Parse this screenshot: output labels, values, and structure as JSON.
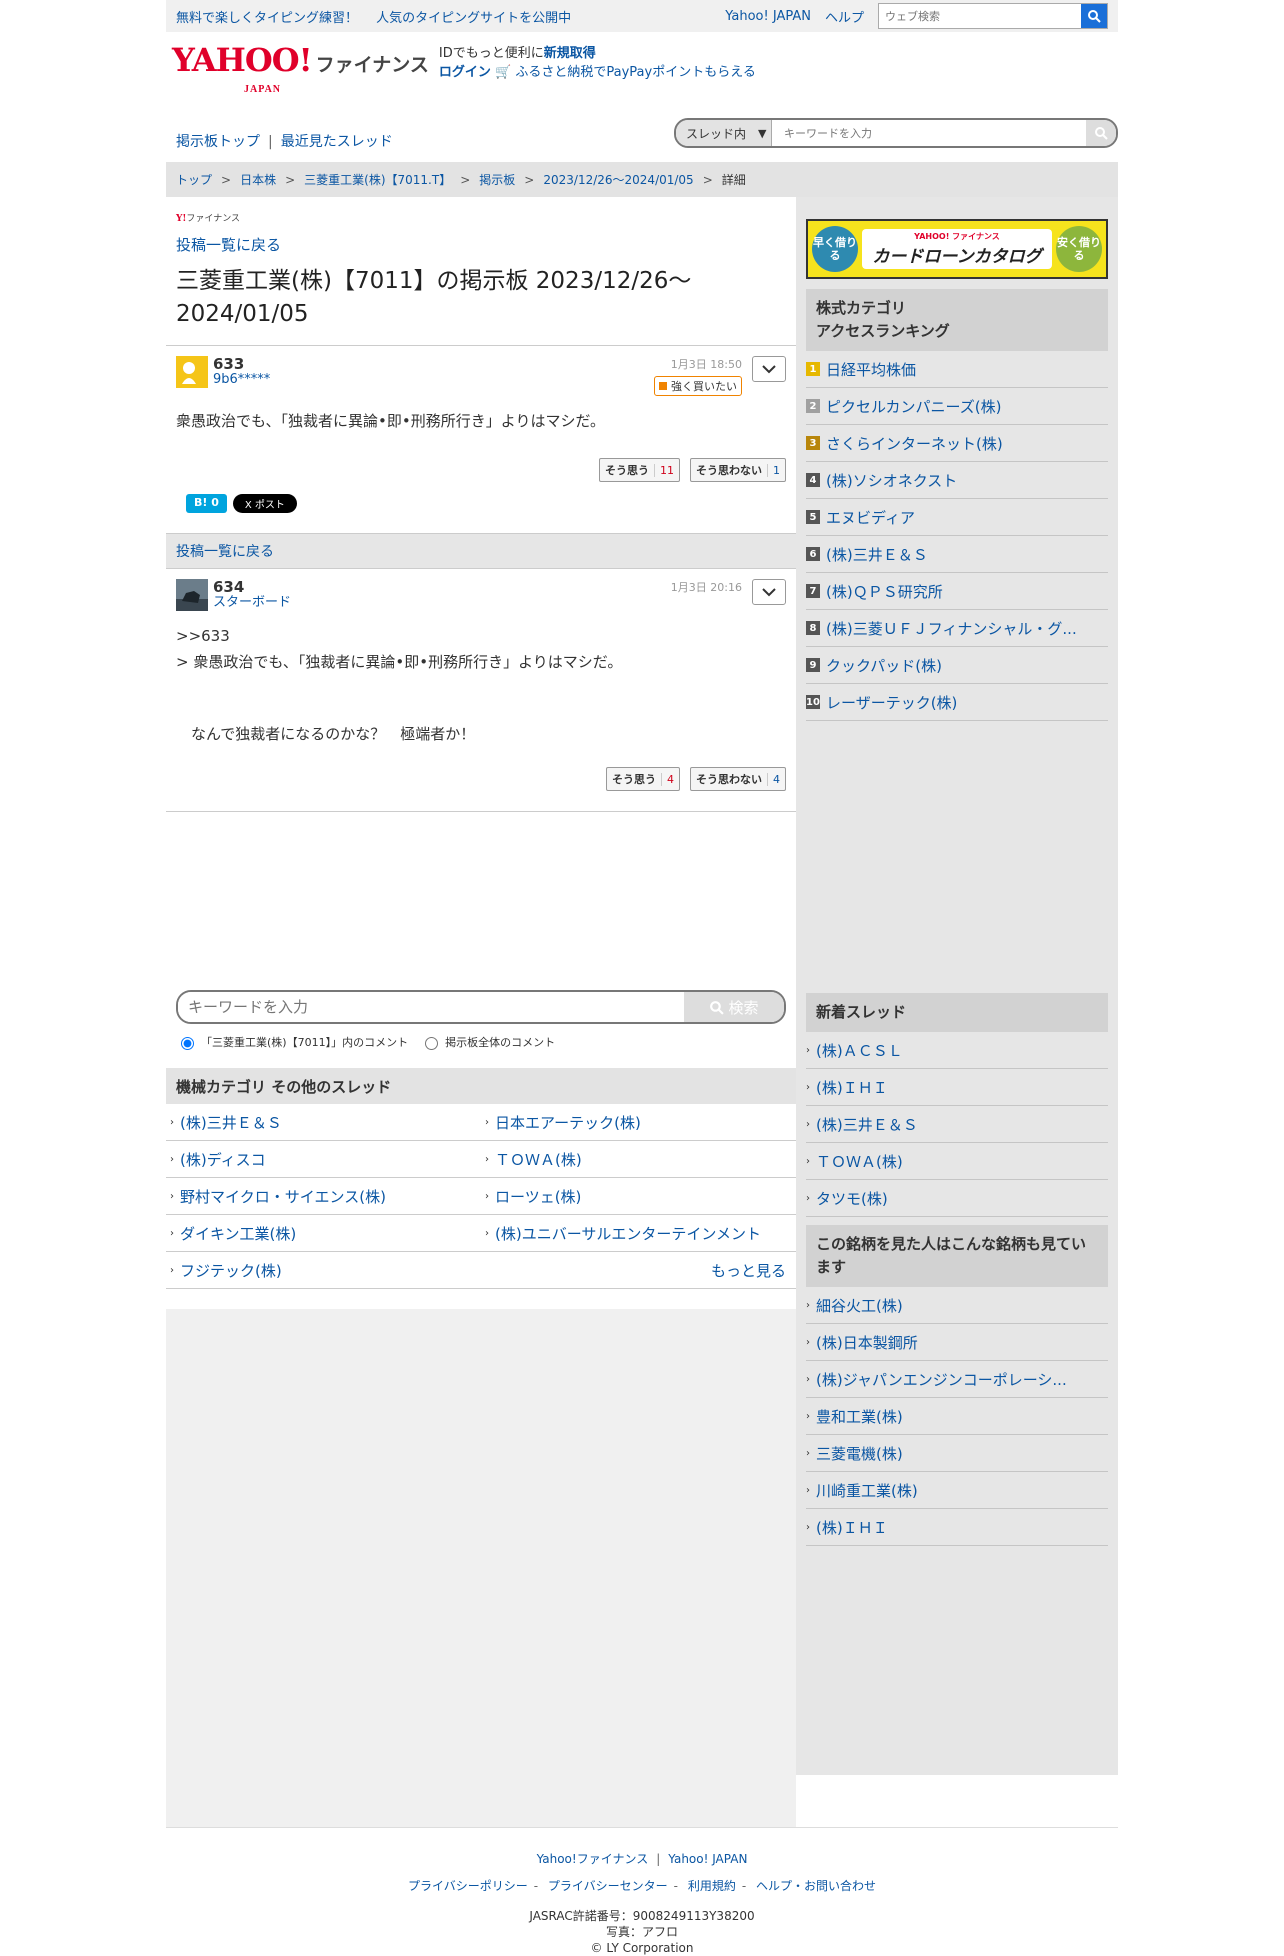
{
  "topbar": {
    "promo1": "無料で楽しくタイピング練習！",
    "promo2": "人気のタイピングサイトを公開中",
    "yahoo_japan": "Yahoo! JAPAN",
    "help": "ヘルプ",
    "web_search_placeholder": "ウェブ検索"
  },
  "header": {
    "logo_yahoo": "YAHOO!",
    "logo_japan": "JAPAN",
    "logo_finance": "ファイナンス",
    "id_text": "IDでもっと便利に",
    "signup": "新規取得",
    "login": "ログイン",
    "furusato": "ふるさと納税でPayPayポイントもらえる"
  },
  "subnav": {
    "board_top": "掲示板トップ",
    "recent_threads": "最近見たスレッド",
    "scope": "スレッド内",
    "search_placeholder": "キーワードを入力"
  },
  "breadcrumb": [
    "トップ",
    "日本株",
    "三菱重工業(株)【7011.T】",
    "掲示板",
    "2023/12/26〜2024/01/05",
    "詳細"
  ],
  "main": {
    "small_logo": "Y!",
    "small_logo_text": "ファイナンス",
    "back_to_list": "投稿一覧に戻る",
    "title": "三菱重工業(株)【7011】の掲示板 2023/12/26〜2024/01/05",
    "posts": [
      {
        "number": "633",
        "user": "9b6*****",
        "time": "1月3日 18:50",
        "sentiment": "強く買いたい",
        "body": "衆愚政治でも、「独裁者に異論•即•刑務所行き」よりはマシだ。",
        "agree_label": "そう思う",
        "agree_count": "11",
        "disagree_label": "そう思わない",
        "disagree_count": "1",
        "hatena_label": "B! 0",
        "x_label": "X ポスト"
      },
      {
        "number": "634",
        "user": "スターボード",
        "time": "1月3日 20:16",
        "body_lines": [
          ">>633",
          "> 衆愚政治でも、「独裁者に異論•即•刑務所行き」よりはマシだ。",
          "",
          "",
          "　なんで独裁者になるのかな？　極端者か！"
        ],
        "agree_label": "そう思う",
        "agree_count": "4",
        "disagree_label": "そう思わない",
        "disagree_count": "4"
      }
    ],
    "back_to_list_2": "投稿一覧に戻る",
    "keyword_placeholder": "キーワードを入力",
    "search_button": "検索",
    "radio_in_thread": "「三菱重工業(株)【7011】」内のコメント",
    "radio_all": "掲示板全体のコメント",
    "other_threads_heading": "機械カテゴリ その他のスレッド",
    "other_threads": [
      "(株)三井Ｅ＆Ｓ",
      "日本エアーテック(株)",
      "(株)ディスコ",
      "ＴＯＷＡ(株)",
      "野村マイクロ・サイエンス(株)",
      "ローツェ(株)",
      "ダイキン工業(株)",
      "(株)ユニバーサルエンターテインメント",
      "フジテック(株)"
    ],
    "more": "もっと見る"
  },
  "side": {
    "banner_left": "早く借りる",
    "banner_top": "YAHOO! ファイナンス",
    "banner_main": "カードローンカタログ",
    "banner_right": "安く借りる",
    "ranking_heading_1": "株式カテゴリ",
    "ranking_heading_2": "アクセスランキング",
    "ranking": [
      "日経平均株価",
      "ピクセルカンパニーズ(株)",
      "さくらインターネット(株)",
      "(株)ソシオネクスト",
      "エヌビディア",
      "(株)三井Ｅ＆Ｓ",
      "(株)ＱＰＳ研究所",
      "(株)三菱ＵＦＪフィナンシャル・グ...",
      "クックパッド(株)",
      "レーザーテック(株)"
    ],
    "rank_colors": [
      "#e6b800",
      "#a0a0a0",
      "#b8860b",
      "#555555",
      "#555555",
      "#555555",
      "#555555",
      "#555555",
      "#555555",
      "#555555"
    ],
    "new_threads_heading": "新着スレッド",
    "new_threads": [
      "(株)ＡＣＳＬ",
      "(株)ＩＨＩ",
      "(株)三井Ｅ＆Ｓ",
      "ＴＯＷＡ(株)",
      "タツモ(株)"
    ],
    "also_viewed_heading": "この銘柄を見た人はこんな銘柄も見ています",
    "also_viewed": [
      "細谷火工(株)",
      "(株)日本製鋼所",
      "(株)ジャパンエンジンコーポレーシ...",
      "豊和工業(株)",
      "三菱電機(株)",
      "川崎重工業(株)",
      "(株)ＩＨＩ"
    ]
  },
  "footer": {
    "yahoo_finance": "Yahoo!ファイナンス",
    "yahoo_japan": "Yahoo! JAPAN",
    "privacy_policy": "プライバシーポリシー",
    "privacy_center": "プライバシーセンター",
    "terms": "利用規約",
    "help_contact": "ヘルプ・お問い合わせ",
    "jasrac": "JASRAC許諾番号：9008249113Y38200",
    "photo": "写真：アフロ",
    "copyright": "© LY Corporation"
  }
}
